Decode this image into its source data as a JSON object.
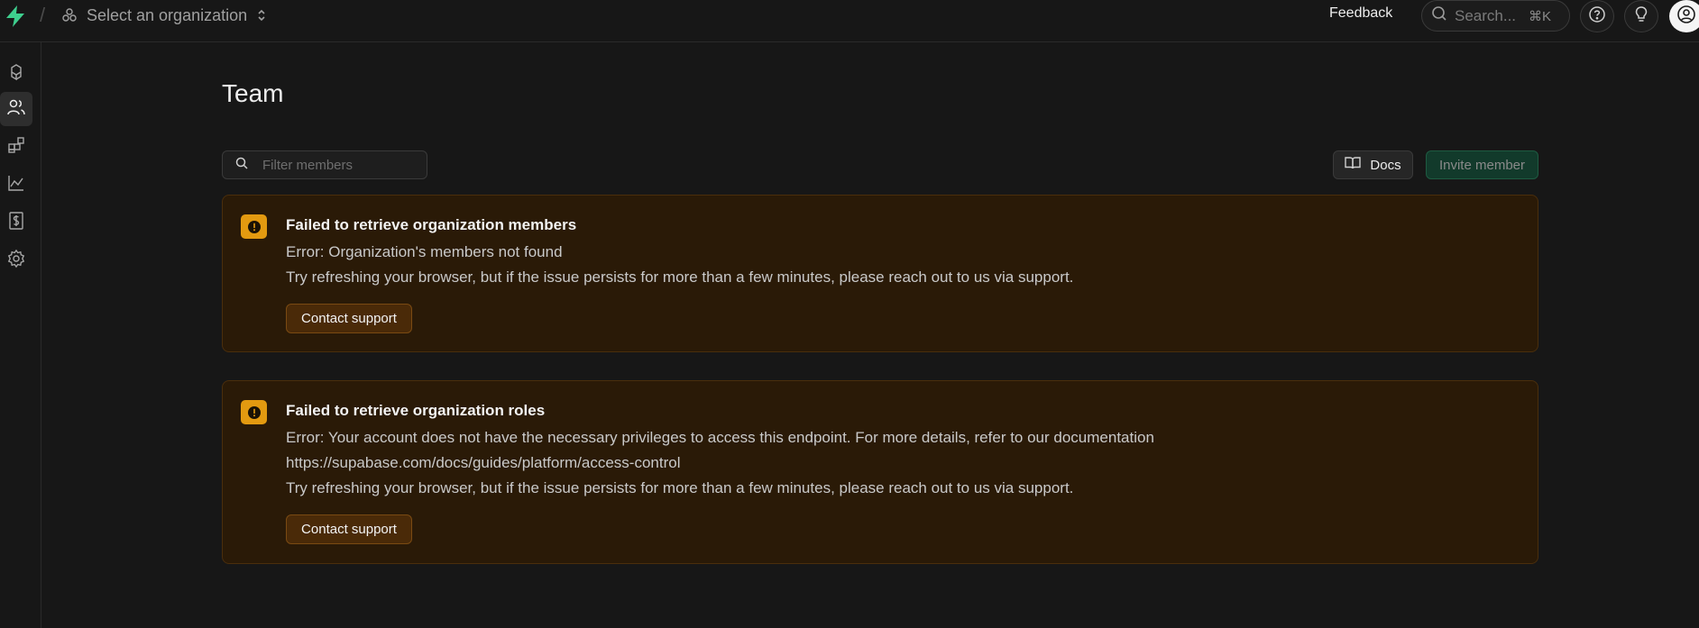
{
  "header": {
    "org_placeholder": "Select an organization",
    "feedback": "Feedback",
    "search_placeholder": "Search...",
    "search_shortcut": "⌘K"
  },
  "page": {
    "title": "Team",
    "filter_placeholder": "Filter members",
    "docs_label": "Docs",
    "invite_label": "Invite member"
  },
  "alerts": [
    {
      "title": "Failed to retrieve organization members",
      "lines": [
        "Error: Organization's members not found",
        "Try refreshing your browser, but if the issue persists for more than a few minutes, please reach out to us via support."
      ],
      "button": "Contact support"
    },
    {
      "title": "Failed to retrieve organization roles",
      "lines": [
        "Error: Your account does not have the necessary privileges to access this endpoint. For more details, refer to our documentation",
        "https://supabase.com/docs/guides/platform/access-control",
        "Try refreshing your browser, but if the issue persists for more than a few minutes, please reach out to us via support."
      ],
      "button": "Contact support"
    }
  ],
  "colors": {
    "background": "#171717",
    "brand": "#3ecf8e",
    "warning": "#e39a10",
    "alert_bg": "#2a1a07"
  },
  "icons": {
    "sidebar": [
      "projects-icon",
      "team-icon",
      "integrations-icon",
      "usage-icon",
      "billing-icon",
      "settings-icon"
    ],
    "header": [
      "supabase-logo",
      "organization-icon",
      "chevron-updown-icon",
      "search-icon",
      "help-icon",
      "lightbulb-icon",
      "user-avatar-icon"
    ]
  }
}
